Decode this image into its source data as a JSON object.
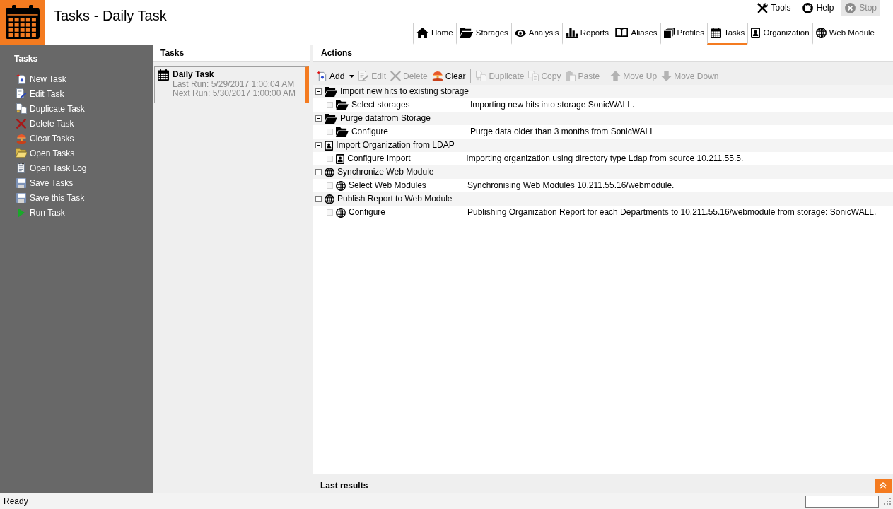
{
  "header": {
    "title": "Tasks - Daily Task",
    "actions": [
      {
        "label": "Tools",
        "disabled": false
      },
      {
        "label": "Help",
        "disabled": false
      },
      {
        "label": "Stop",
        "disabled": true
      }
    ]
  },
  "nav_tabs": [
    {
      "label": "Home",
      "selected": false
    },
    {
      "label": "Storages",
      "selected": false
    },
    {
      "label": "Analysis",
      "selected": false
    },
    {
      "label": "Reports",
      "selected": false
    },
    {
      "label": "Aliases",
      "selected": false
    },
    {
      "label": "Profiles",
      "selected": false
    },
    {
      "label": "Tasks",
      "selected": true
    },
    {
      "label": "Organization",
      "selected": false
    },
    {
      "label": "Web Module",
      "selected": false
    }
  ],
  "sidebar": {
    "title": "Tasks",
    "items": [
      {
        "label": "New Task"
      },
      {
        "label": "Edit Task"
      },
      {
        "label": "Duplicate Task"
      },
      {
        "label": "Delete Task"
      },
      {
        "label": "Clear Tasks"
      },
      {
        "label": "Open Tasks"
      },
      {
        "label": "Open Task Log"
      },
      {
        "label": "Save Tasks"
      },
      {
        "label": "Save this Task"
      },
      {
        "label": "Run Task"
      }
    ]
  },
  "tasks_panel": {
    "title": "Tasks",
    "tasks": [
      {
        "name": "Daily Task",
        "last_run": "Last Run: 5/29/2017 1:00:04 AM",
        "next_run": "Next Run: 5/30/2017 1:00:00 AM",
        "selected": true
      }
    ]
  },
  "actions_panel": {
    "title": "Actions",
    "toolbar": {
      "groups": [
        {
          "buttons": [
            {
              "label": "Add",
              "disabled": false,
              "dropdown": true
            },
            {
              "label": "Edit",
              "disabled": true,
              "dropdown": false
            },
            {
              "label": "Delete",
              "disabled": true,
              "dropdown": false
            },
            {
              "label": "Clear",
              "disabled": false,
              "dropdown": false
            }
          ]
        },
        {
          "buttons": [
            {
              "label": "Duplicate",
              "disabled": true,
              "dropdown": false
            },
            {
              "label": "Copy",
              "disabled": true,
              "dropdown": false
            },
            {
              "label": "Paste",
              "disabled": true,
              "dropdown": false
            }
          ]
        },
        {
          "buttons": [
            {
              "label": "Move Up",
              "disabled": true,
              "dropdown": false
            },
            {
              "label": "Move Down",
              "disabled": true,
              "dropdown": false
            }
          ]
        }
      ]
    },
    "tree": [
      {
        "label": "Import new hits to existing storage",
        "expanded": true,
        "children": [
          {
            "label": "Select storages",
            "description": "Importing new hits into storage SonicWALL.",
            "checked": false
          }
        ]
      },
      {
        "label": "Purge datafrom Storage",
        "expanded": true,
        "children": [
          {
            "label": "Configure",
            "description": "Purge data older than 3 months from SonicWALL",
            "checked": false
          }
        ]
      },
      {
        "label": "Import Organization from LDAP",
        "expanded": true,
        "children": [
          {
            "label": "Configure Import",
            "description": "Importing organization using directory type Ldap from source 10.211.55.5.",
            "checked": false
          }
        ]
      },
      {
        "label": "Synchronize Web Module",
        "expanded": true,
        "children": [
          {
            "label": "Select Web Modules",
            "description": "Synchronising Web Modules 10.211.55.16/webmodule.",
            "checked": false
          }
        ]
      },
      {
        "label": "Publish Report to Web Module",
        "expanded": true,
        "children": [
          {
            "label": "Configure",
            "description": "Publishing Organization Report for each Departments to 10.211.55.16/webmodule from storage: SonicWALL.",
            "checked": false
          }
        ]
      }
    ]
  },
  "last_results": {
    "title": "Last results",
    "expanded": false
  },
  "status_bar": {
    "text": "Ready"
  }
}
